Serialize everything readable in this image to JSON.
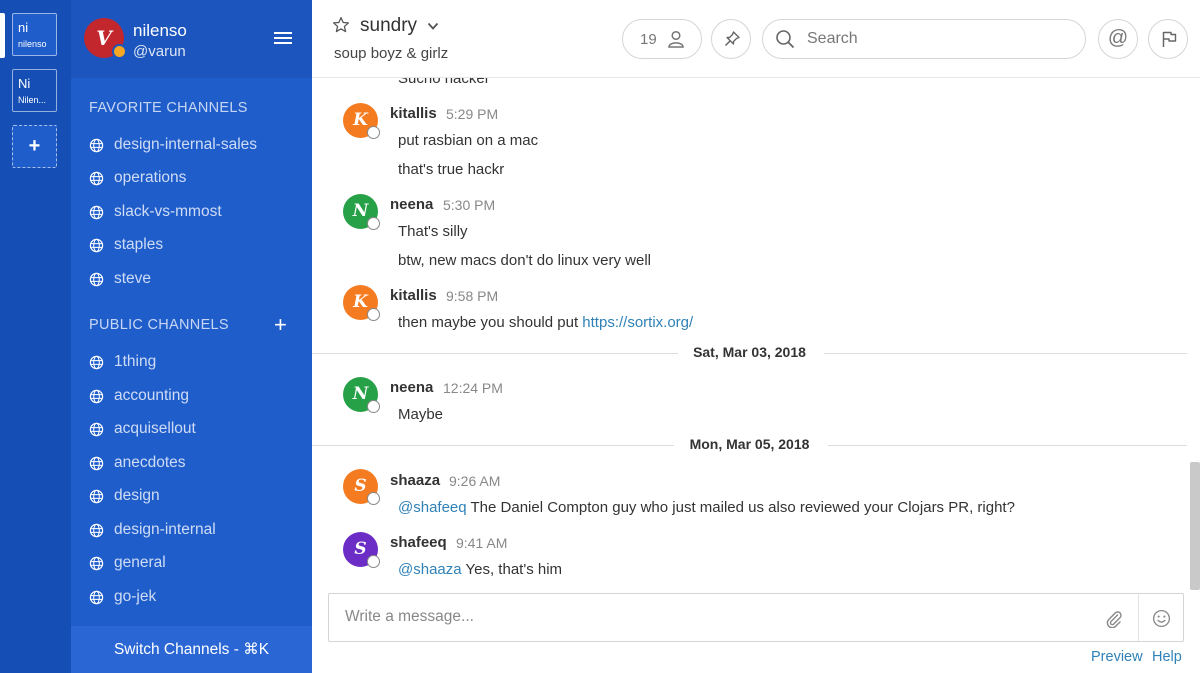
{
  "teams": [
    {
      "abbr": "ni",
      "name": "nilenso"
    },
    {
      "abbr": "Ni",
      "name": "Nilen..."
    }
  ],
  "team_add": "+",
  "sidebar": {
    "team_name": "nilenso",
    "user_handle": "@varun",
    "avatar_letter": "V",
    "favorite_title": "FAVORITE CHANNELS",
    "favorites": [
      "design-internal-sales",
      "operations",
      "slack-vs-mmost",
      "staples",
      "steve"
    ],
    "public_title": "PUBLIC CHANNELS",
    "public_add": "+",
    "public": [
      "1thing",
      "accounting",
      "acquisellout",
      "anecdotes",
      "design",
      "design-internal",
      "general",
      "go-jek"
    ],
    "switch_label": "Switch Channels - ⌘K"
  },
  "header": {
    "channel_name": "sundry",
    "purpose": "soup boyz & girlz",
    "member_count": "19",
    "search_placeholder": "Search",
    "mentions_glyph": "@"
  },
  "messages": {
    "cut_text": "Sucho hacker",
    "posts": [
      {
        "letter": "K",
        "user": "kitallis",
        "time": "5:29 PM",
        "lines": [
          "put rasbian on a mac",
          "that's true hackr"
        ]
      },
      {
        "letter": "N",
        "user": "neena",
        "time": "5:30 PM",
        "lines": [
          "That's silly",
          "btw, new macs don't do linux very well"
        ]
      },
      {
        "letter": "K",
        "user": "kitallis",
        "time": "9:58 PM",
        "text": "then maybe you should put ",
        "link": "https://sortix.org/"
      },
      {
        "letter": "N",
        "user": "neena",
        "time": "12:24 PM",
        "lines": [
          "Maybe"
        ]
      },
      {
        "letter": "S",
        "user": "shaaza",
        "time": "9:26 AM",
        "mention": "@shafeeq",
        "text": " The Daniel Compton guy who just mailed us also reviewed your Clojars PR, right?"
      },
      {
        "letter": "S",
        "user": "shafeeq",
        "time": "9:41 AM",
        "mention": "@shaaza",
        "text": " Yes, that's him"
      }
    ],
    "date_separators": [
      "Sat, Mar 03, 2018",
      "Mon, Mar 05, 2018"
    ]
  },
  "composer": {
    "placeholder": "Write a message..."
  },
  "footer": {
    "preview": "Preview",
    "help": "Help"
  },
  "colors": {
    "team_rail": "#154eb5",
    "sidebar": "#1f5dcb",
    "avatar_kitallis": "#f47b20",
    "avatar_neena": "#27a148",
    "avatar_shaaza": "#f47b20",
    "avatar_shafeeq": "#6c2dc7",
    "link": "#2f81b7"
  },
  "icons": [
    "globe-icon",
    "hamburger-icon",
    "star-icon",
    "chevron-down-icon",
    "member-icon",
    "pin-icon",
    "search-icon",
    "at-icon",
    "flag-icon",
    "paperclip-icon",
    "emoji-icon"
  ]
}
